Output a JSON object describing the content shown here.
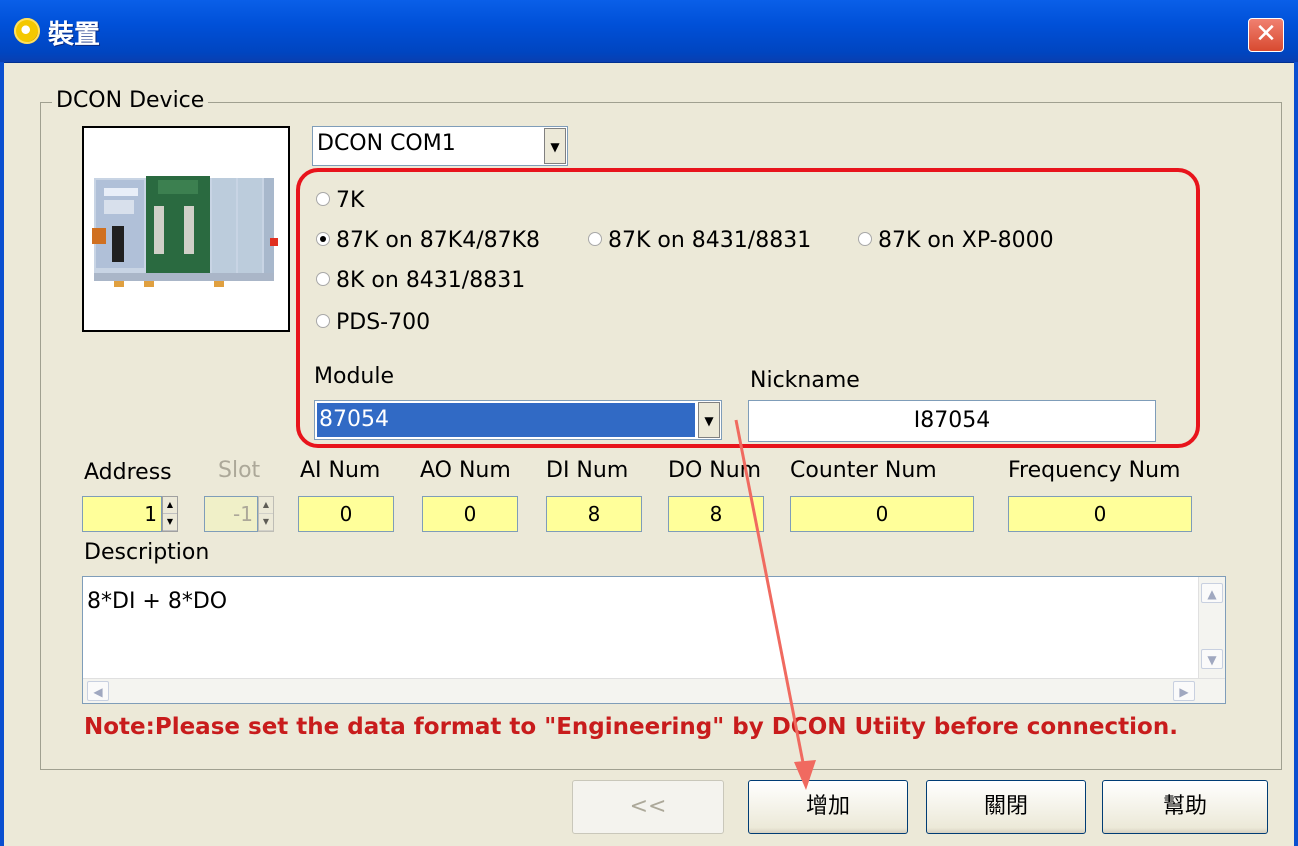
{
  "window": {
    "title": "裝置",
    "close_label": "✕"
  },
  "group": {
    "label": "DCON Device"
  },
  "port_select": {
    "value": "DCON  COM1"
  },
  "protocols": [
    {
      "label": "7K",
      "selected": false
    },
    {
      "label": "87K on 87K4/87K8",
      "selected": true
    },
    {
      "label": "87K on 8431/8831",
      "selected": false
    },
    {
      "label": "87K on XP-8000",
      "selected": false
    },
    {
      "label": "8K on 8431/8831",
      "selected": false
    },
    {
      "label": "PDS-700",
      "selected": false
    }
  ],
  "module": {
    "label": "Module",
    "value": "87054"
  },
  "nickname": {
    "label": "Nickname",
    "value": "I87054"
  },
  "fields": {
    "address": {
      "label": "Address",
      "value": "1"
    },
    "slot": {
      "label": "Slot",
      "value": "-1"
    },
    "ai_num": {
      "label": "AI Num",
      "value": "0"
    },
    "ao_num": {
      "label": "AO Num",
      "value": "0"
    },
    "di_num": {
      "label": "DI Num",
      "value": "8"
    },
    "do_num": {
      "label": "DO Num",
      "value": "8"
    },
    "counter_num": {
      "label": "Counter Num",
      "value": "0"
    },
    "frequency_num": {
      "label": "Frequency Num",
      "value": "0"
    }
  },
  "description": {
    "label": "Description",
    "value": "8*DI + 8*DO"
  },
  "note": "Note:Please set the data format to \"Engineering\" by DCON Utiity before connection.",
  "buttons": {
    "back": "<<",
    "add": "增加",
    "close": "關閉",
    "help": "幫助"
  },
  "colors": {
    "highlight": "#e8141c",
    "note": "#c81c1c",
    "field_yellow": "#ffff9a"
  }
}
